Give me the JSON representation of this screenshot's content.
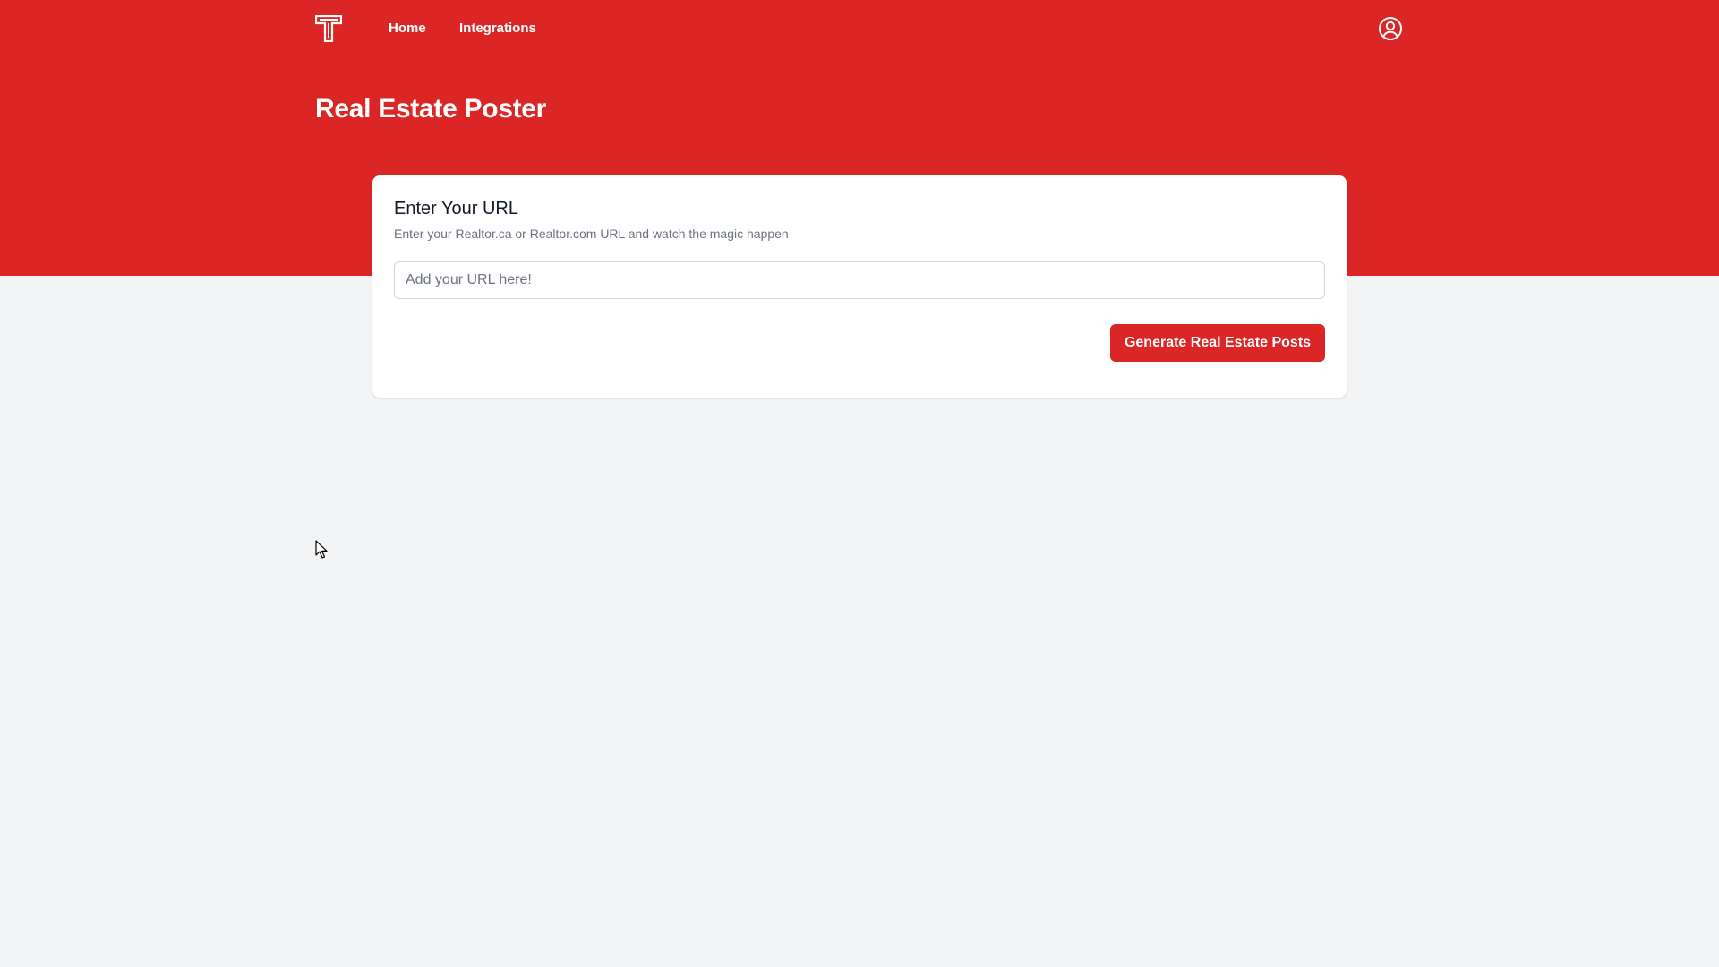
{
  "nav": {
    "logo_icon": "t-logo-icon",
    "links": [
      {
        "label": "Home"
      },
      {
        "label": "Integrations"
      }
    ],
    "user_icon": "user-circle-icon"
  },
  "page": {
    "title": "Real Estate Poster"
  },
  "card": {
    "title": "Enter Your URL",
    "subtitle": "Enter your Realtor.ca or Realtor.com URL and watch the magic happen",
    "input": {
      "value": "",
      "placeholder": "Add your URL here!"
    },
    "button_label": "Generate Real Estate Posts"
  },
  "colors": {
    "brand_red": "#dc2626",
    "page_background": "#f3f4f6",
    "card_background": "#ffffff",
    "muted_text": "#6b7280"
  }
}
